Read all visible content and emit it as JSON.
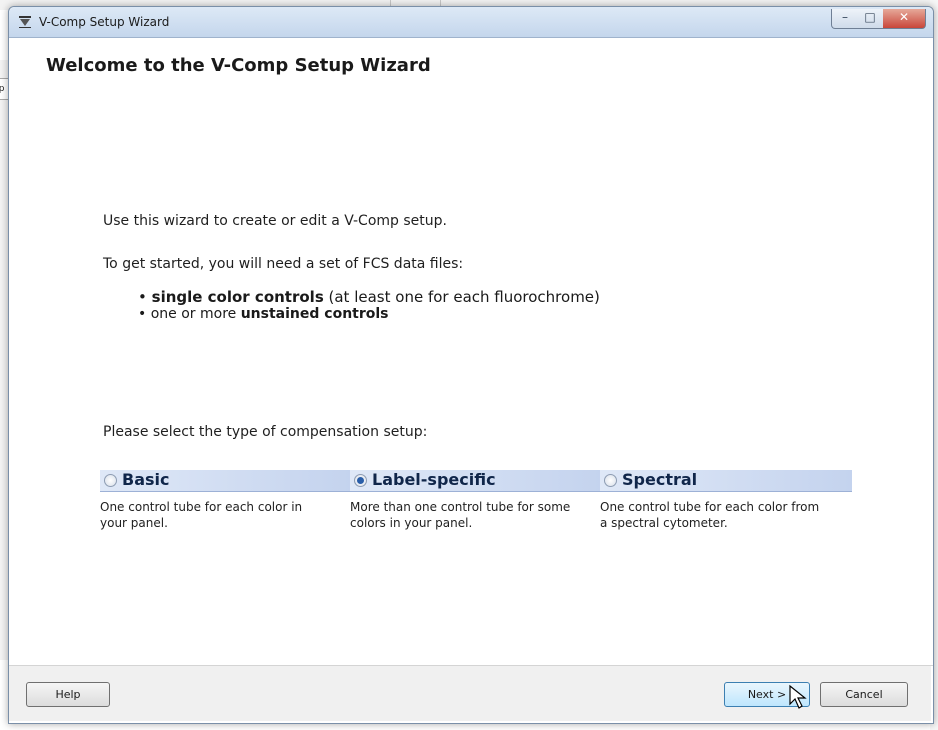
{
  "window": {
    "title": "V-Comp Setup Wizard"
  },
  "background": {
    "tab_fragment": "up"
  },
  "heading": "Welcome to the V-Comp Setup Wizard",
  "intro": {
    "line1": "Use this wizard to create or edit a V-Comp setup.",
    "line2": "To get started, you will need a set of FCS data files:",
    "bullet1_bold": "single color controls",
    "bullet1_rest": " (at least one for each fluorochrome)",
    "bullet2_pre": "one or more ",
    "bullet2_bold": "unstained controls"
  },
  "select_prompt": "Please select the type of compensation setup:",
  "options": [
    {
      "label": "Basic",
      "description": "One control tube for each color in your panel.",
      "selected": false
    },
    {
      "label": "Label-specific",
      "description": "More than one control tube for some colors in your panel.",
      "selected": true
    },
    {
      "label": "Spectral",
      "description": "One control tube for each color from a spectral cytometer.",
      "selected": false
    }
  ],
  "buttons": {
    "help": "Help",
    "next": "Next >",
    "cancel": "Cancel"
  },
  "colors": {
    "accent": "#2a5ea8",
    "option_header": "#c4d3ee",
    "titlebar": "#c4d6ec"
  }
}
